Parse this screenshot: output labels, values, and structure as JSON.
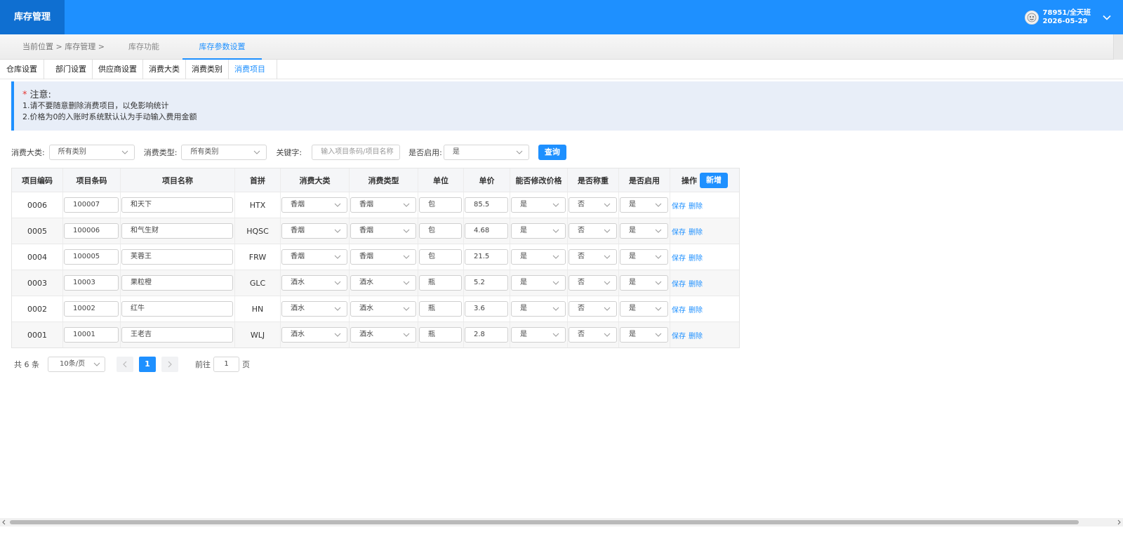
{
  "header": {
    "brand": "库存管理",
    "user_name": "78951/全天班",
    "user_date": "2026-05-29"
  },
  "subnav": {
    "breadcrumb": "当前位置 >  库存管理 >",
    "tabs": [
      "库存功能",
      "库存参数设置"
    ],
    "active_tab": "库存参数设置"
  },
  "tabs": [
    "仓库设置",
    "部门设置",
    "供应商设置",
    "消费大类",
    "消费类别",
    "消费项目"
  ],
  "active_tab": "消费项目",
  "notice": {
    "star": "*",
    "title": "注意:",
    "lines": [
      "1.请不要随意删除消费项目，以免影响统计",
      "2.价格为0的入账时系统默认认为手动输入费用金额"
    ]
  },
  "filters": {
    "category_label": "消费大类:",
    "category_value": "所有类别",
    "type_label": "消费类型:",
    "type_value": "所有类别",
    "keyword_label": "关键字:",
    "keyword_placeholder": "输入项目条码/项目名称",
    "enabled_label": "是否启用:",
    "enabled_value": "是",
    "query_button": "查询"
  },
  "table": {
    "headers": [
      "项目编码",
      "项目条码",
      "项目名称",
      "首拼",
      "消费大类",
      "消费类型",
      "单位",
      "单价",
      "能否修改价格",
      "是否称重",
      "是否启用",
      "操作"
    ],
    "add_button": "新增",
    "save_label": "保存",
    "delete_label": "删除",
    "rows": [
      {
        "code": "0006",
        "barcode": "100007",
        "name": "和天下",
        "pinyin": "HTX",
        "category": "香烟",
        "type": "香烟",
        "unit": "包",
        "price": "85.5",
        "editable": "是",
        "weigh": "否",
        "enabled": "是"
      },
      {
        "code": "0005",
        "barcode": "100006",
        "name": "和气生财",
        "pinyin": "HQSC",
        "category": "香烟",
        "type": "香烟",
        "unit": "包",
        "price": "4.68",
        "editable": "是",
        "weigh": "否",
        "enabled": "是"
      },
      {
        "code": "0004",
        "barcode": "100005",
        "name": "芙蓉王",
        "pinyin": "FRW",
        "category": "香烟",
        "type": "香烟",
        "unit": "包",
        "price": "21.5",
        "editable": "是",
        "weigh": "否",
        "enabled": "是"
      },
      {
        "code": "0003",
        "barcode": "10003",
        "name": "果粒橙",
        "pinyin": "GLC",
        "category": "酒水",
        "type": "酒水",
        "unit": "瓶",
        "price": "5.2",
        "editable": "是",
        "weigh": "否",
        "enabled": "是"
      },
      {
        "code": "0002",
        "barcode": "10002",
        "name": "红牛",
        "pinyin": "HN",
        "category": "酒水",
        "type": "酒水",
        "unit": "瓶",
        "price": "3.6",
        "editable": "是",
        "weigh": "否",
        "enabled": "是"
      },
      {
        "code": "0001",
        "barcode": "10001",
        "name": "王老吉",
        "pinyin": "WLJ",
        "category": "酒水",
        "type": "酒水",
        "unit": "瓶",
        "price": "2.8",
        "editable": "是",
        "weigh": "否",
        "enabled": "是"
      }
    ]
  },
  "pagination": {
    "total": "共 6 条",
    "page_size": "10条/页",
    "current_page": "1",
    "goto_label": "前往",
    "goto_value": "1",
    "page_label": "页"
  },
  "colors": {
    "accent": "#1e90ff",
    "brand_bg": "#0f6fd1",
    "notice_bg": "#e8eef8",
    "required_star": "#e53935"
  }
}
